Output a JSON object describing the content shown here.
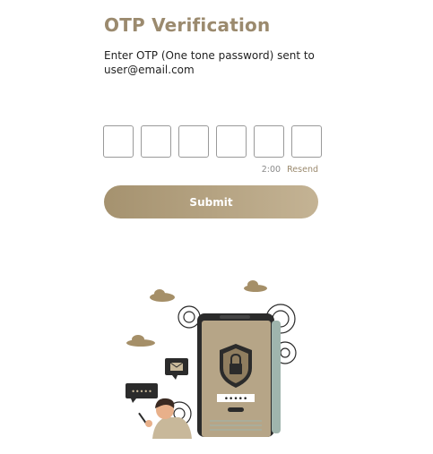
{
  "header": {
    "title": "OTP Verification"
  },
  "instructions": {
    "text": "Enter OTP (One tone password) sent to user@email.com"
  },
  "otp": {
    "digits": [
      "",
      "",
      "",
      "",
      "",
      ""
    ]
  },
  "timer": {
    "time": "2:00",
    "resend_label": "Resend"
  },
  "actions": {
    "submit_label": "Submit"
  },
  "illustration": {
    "phone_code_mask": "•••••",
    "chat_bubble_mask": "•••••"
  },
  "colors": {
    "accent": "#9b8a6e",
    "button_gradient_start": "#a5926f",
    "button_gradient_end": "#c4b394"
  }
}
